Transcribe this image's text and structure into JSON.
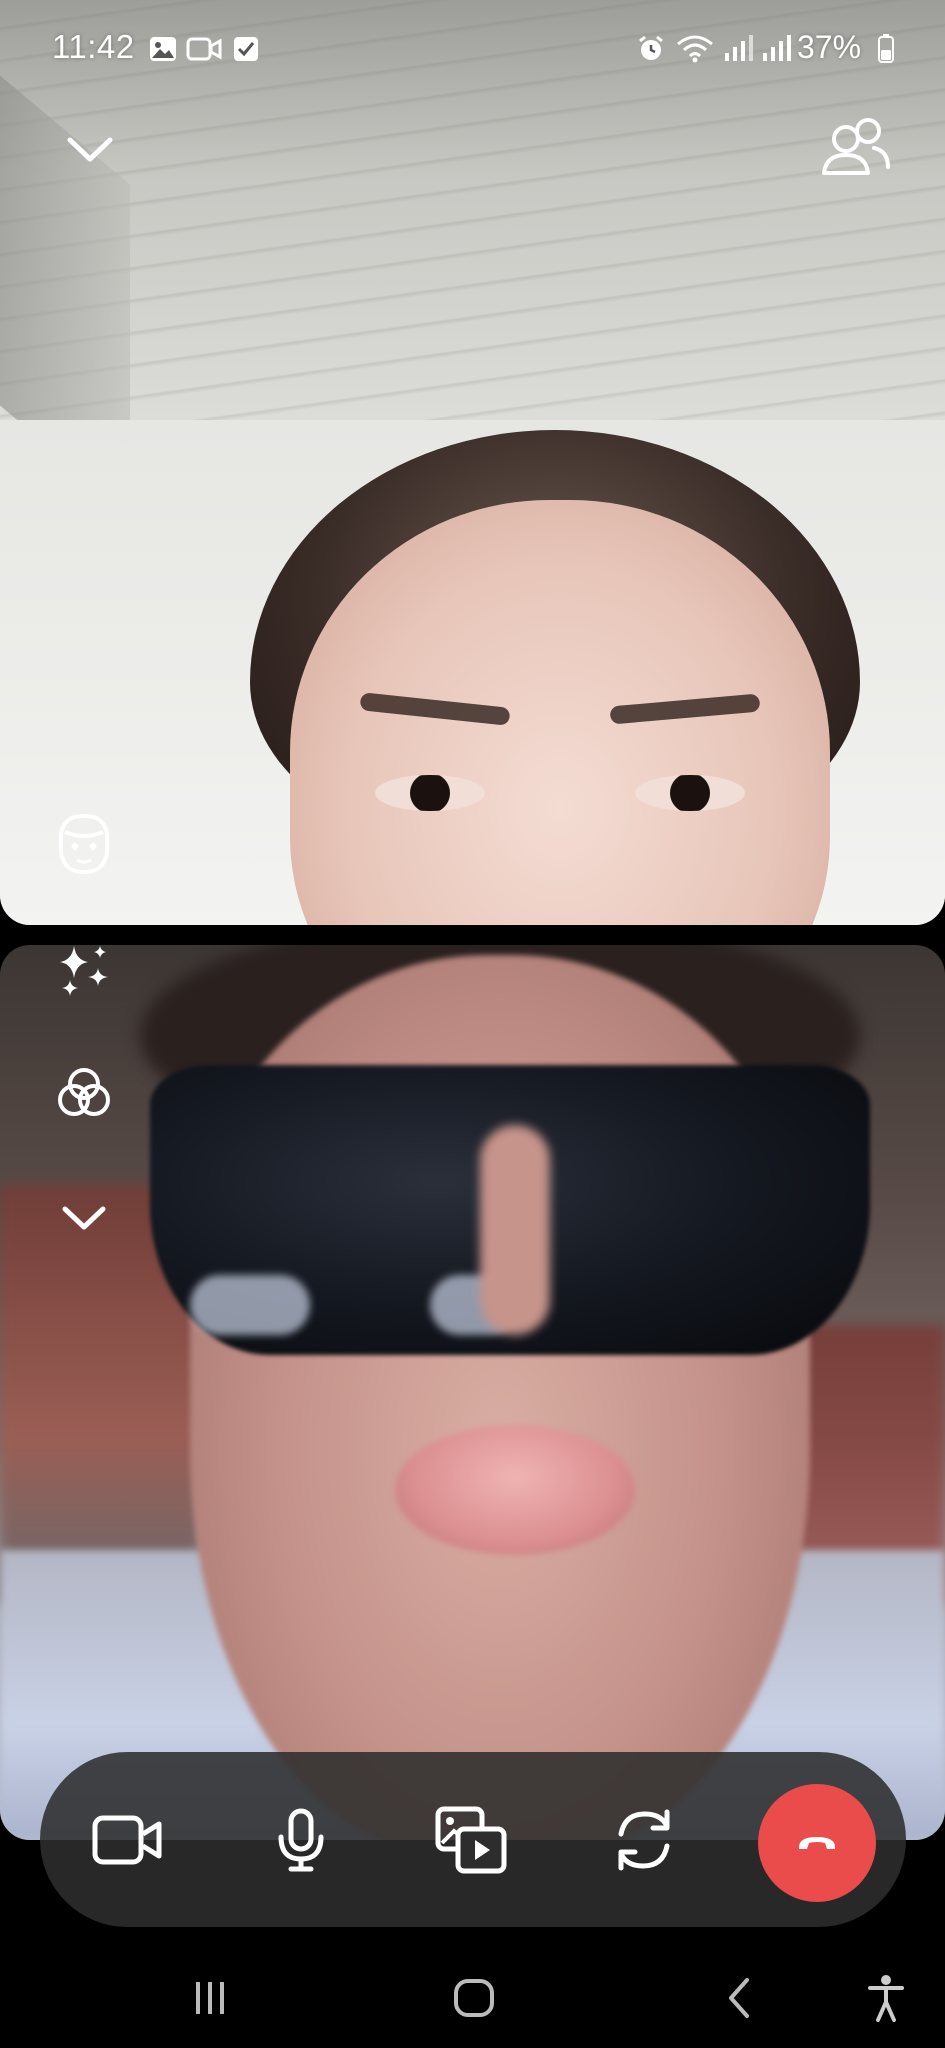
{
  "status_bar": {
    "time": "11:42",
    "battery_percent": "37%",
    "left_icons": [
      "gallery-icon",
      "video-icon",
      "checkbox-icon"
    ],
    "right_icons": [
      "alarm-icon",
      "wifi-icon",
      "signal-icon",
      "signal-icon",
      "battery-icon"
    ]
  },
  "call": {
    "top_controls": {
      "collapse": "chevron-down-icon",
      "participants": "people-icon"
    },
    "side_tools": [
      "face-effect-icon",
      "sparkles-icon",
      "filters-icon",
      "chevron-down-icon"
    ]
  },
  "controls": {
    "buttons": [
      "video-camera-icon",
      "microphone-icon",
      "share-media-icon",
      "flip-camera-icon",
      "end-call-icon"
    ],
    "accent_end_call": "#ea4b4b",
    "bar_color": "#2d2d2d"
  },
  "system_nav": [
    "recent-apps-icon",
    "home-icon",
    "back-icon",
    "accessibility-icon"
  ]
}
